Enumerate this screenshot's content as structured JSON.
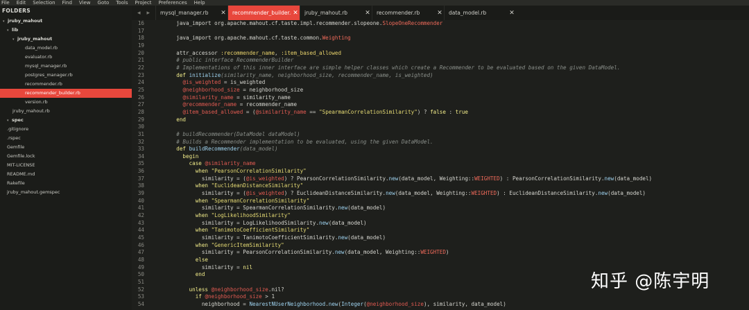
{
  "menu": [
    "File",
    "Edit",
    "Selection",
    "Find",
    "View",
    "Goto",
    "Tools",
    "Project",
    "Preferences",
    "Help"
  ],
  "sidebar": {
    "header": "FOLDERS",
    "items": [
      {
        "label": "jruby_mahout",
        "type": "folder",
        "depth": 0
      },
      {
        "label": "lib",
        "type": "folder",
        "depth": 1
      },
      {
        "label": "jruby_mahout",
        "type": "folder",
        "depth": 2
      },
      {
        "label": "data_model.rb",
        "type": "file",
        "depth": 3
      },
      {
        "label": "evaluator.rb",
        "type": "file",
        "depth": 3
      },
      {
        "label": "mysql_manager.rb",
        "type": "file",
        "depth": 3
      },
      {
        "label": "postgres_manager.rb",
        "type": "file",
        "depth": 3
      },
      {
        "label": "recommender.rb",
        "type": "file",
        "depth": 3
      },
      {
        "label": "recommender_builder.rb",
        "type": "file",
        "depth": 3,
        "active": true
      },
      {
        "label": "version.rb",
        "type": "file",
        "depth": 3
      },
      {
        "label": "jruby_mahout.rb",
        "type": "file",
        "depth": 2
      },
      {
        "label": "spec",
        "type": "folder",
        "depth": 1
      },
      {
        "label": ".gitignore",
        "type": "file",
        "depth": 1
      },
      {
        "label": ".rspec",
        "type": "file",
        "depth": 1
      },
      {
        "label": "Gemfile",
        "type": "file",
        "depth": 1
      },
      {
        "label": "Gemfile.lock",
        "type": "file",
        "depth": 1
      },
      {
        "label": "MIT-LICENSE",
        "type": "file",
        "depth": 1
      },
      {
        "label": "README.md",
        "type": "file",
        "depth": 1
      },
      {
        "label": "Rakefile",
        "type": "file",
        "depth": 1
      },
      {
        "label": "jruby_mahout.gemspec",
        "type": "file",
        "depth": 1
      }
    ]
  },
  "tabs": {
    "nav_left": "◂",
    "nav_right": "▸",
    "close_glyph": "✕",
    "items": [
      {
        "label": "mysql_manager.rb",
        "active": false
      },
      {
        "label": "recommender_builder.rb",
        "active": true
      },
      {
        "label": "jruby_mahout.rb",
        "active": false
      },
      {
        "label": "recommender.rb",
        "active": false
      },
      {
        "label": "data_model.rb",
        "active": false
      }
    ]
  },
  "editor": {
    "lines": [
      {
        "n": "16",
        "t": [
          [
            "    java_import org.apache.mahout.cf.taste.impl.recommender.slopeone.",
            "plain"
          ],
          [
            "SlopeOneRecommender",
            "const"
          ]
        ]
      },
      {
        "n": "17",
        "t": []
      },
      {
        "n": "18",
        "t": [
          [
            "    java_import org.apache.mahout.cf.taste.common.",
            "plain"
          ],
          [
            "Weighting",
            "const"
          ]
        ]
      },
      {
        "n": "19",
        "t": []
      },
      {
        "n": "20",
        "t": [
          [
            "    attr_accessor ",
            "plain"
          ],
          [
            ":recommender_name",
            "sym"
          ],
          [
            ", ",
            "plain"
          ],
          [
            ":item_based_allowed",
            "sym"
          ]
        ]
      },
      {
        "n": "21",
        "t": [
          [
            "    # public interface RecommenderBuilder",
            "cmt"
          ]
        ]
      },
      {
        "n": "22",
        "t": [
          [
            "    # Implementations of this inner interface are simple helper classes which create a Recommender to be evaluated based on the given DataModel.",
            "cmt"
          ]
        ]
      },
      {
        "n": "23",
        "t": [
          [
            "    def ",
            "kw"
          ],
          [
            "initialize",
            "fn"
          ],
          [
            "(similarity_name, neighborhood_size, recommender_name, is_weighted)",
            "cmt"
          ]
        ]
      },
      {
        "n": "24",
        "t": [
          [
            "      ",
            "plain"
          ],
          [
            "@is_weighted",
            "ivar"
          ],
          [
            " = is_weighted",
            "plain"
          ]
        ]
      },
      {
        "n": "25",
        "t": [
          [
            "      ",
            "plain"
          ],
          [
            "@neighborhood_size",
            "ivar"
          ],
          [
            " = neighborhood_size",
            "plain"
          ]
        ]
      },
      {
        "n": "26",
        "t": [
          [
            "      ",
            "plain"
          ],
          [
            "@similarity_name",
            "ivar"
          ],
          [
            " = similarity_name",
            "plain"
          ]
        ]
      },
      {
        "n": "27",
        "t": [
          [
            "      ",
            "plain"
          ],
          [
            "@recommender_name",
            "ivar"
          ],
          [
            " = recommender_name",
            "plain"
          ]
        ]
      },
      {
        "n": "28",
        "t": [
          [
            "      ",
            "plain"
          ],
          [
            "@item_based_allowed",
            "ivar"
          ],
          [
            " = (",
            "plain"
          ],
          [
            "@similarity_name",
            "ivar"
          ],
          [
            " == ",
            "plain"
          ],
          [
            "\"SpearmanCorrelationSimilarity\"",
            "str"
          ],
          [
            ") ? ",
            "plain"
          ],
          [
            "false",
            "kw"
          ],
          [
            " : ",
            "plain"
          ],
          [
            "true",
            "kw"
          ]
        ]
      },
      {
        "n": "29",
        "t": [
          [
            "    end",
            "kw"
          ]
        ]
      },
      {
        "n": "30",
        "t": []
      },
      {
        "n": "31",
        "t": [
          [
            "    # buildRecommender(DataModel dataModel)",
            "cmt"
          ]
        ]
      },
      {
        "n": "32",
        "t": [
          [
            "    # Builds a Recommender implementation to be evaluated, using the given DataModel.",
            "cmt"
          ]
        ]
      },
      {
        "n": "33",
        "t": [
          [
            "    def ",
            "kw"
          ],
          [
            "buildRecommender",
            "fn"
          ],
          [
            "(data_model)",
            "cmt"
          ]
        ]
      },
      {
        "n": "34",
        "t": [
          [
            "      begin",
            "kw"
          ]
        ]
      },
      {
        "n": "35",
        "t": [
          [
            "        case ",
            "kw"
          ],
          [
            "@similarity_name",
            "ivar"
          ]
        ]
      },
      {
        "n": "36",
        "t": [
          [
            "          when ",
            "kw"
          ],
          [
            "\"PearsonCorrelationSimilarity\"",
            "str"
          ]
        ]
      },
      {
        "n": "37",
        "t": [
          [
            "            similarity = (",
            "plain"
          ],
          [
            "@is_weighted",
            "ivar"
          ],
          [
            ") ? PearsonCorrelationSimilarity.",
            "plain"
          ],
          [
            "new",
            "fn"
          ],
          [
            "(data_model, Weighting::",
            "plain"
          ],
          [
            "WEIGHTED",
            "const"
          ],
          [
            ") : PearsonCorrelationSimilarity.",
            "plain"
          ],
          [
            "new",
            "fn"
          ],
          [
            "(data_model)",
            "plain"
          ]
        ]
      },
      {
        "n": "38",
        "t": [
          [
            "          when ",
            "kw"
          ],
          [
            "\"EuclideanDistanceSimilarity\"",
            "str"
          ]
        ]
      },
      {
        "n": "39",
        "t": [
          [
            "            similarity = (",
            "plain"
          ],
          [
            "@is_weighted",
            "ivar"
          ],
          [
            ") ? EuclideanDistanceSimilarity.",
            "plain"
          ],
          [
            "new",
            "fn"
          ],
          [
            "(data_model, Weighting::",
            "plain"
          ],
          [
            "WEIGHTED",
            "const"
          ],
          [
            ") : EuclideanDistanceSimilarity.",
            "plain"
          ],
          [
            "new",
            "fn"
          ],
          [
            "(data_model)",
            "plain"
          ]
        ]
      },
      {
        "n": "40",
        "t": [
          [
            "          when ",
            "kw"
          ],
          [
            "\"SpearmanCorrelationSimilarity\"",
            "str"
          ]
        ]
      },
      {
        "n": "41",
        "t": [
          [
            "            similarity = SpearmanCorrelationSimilarity.",
            "plain"
          ],
          [
            "new",
            "fn"
          ],
          [
            "(data_model)",
            "plain"
          ]
        ]
      },
      {
        "n": "42",
        "t": [
          [
            "          when ",
            "kw"
          ],
          [
            "\"LogLikelihoodSimilarity\"",
            "str"
          ]
        ]
      },
      {
        "n": "43",
        "t": [
          [
            "            similarity = LogLikelihoodSimilarity.",
            "plain"
          ],
          [
            "new",
            "fn"
          ],
          [
            "(data_model)",
            "plain"
          ]
        ]
      },
      {
        "n": "44",
        "t": [
          [
            "          when ",
            "kw"
          ],
          [
            "\"TanimotoCoefficientSimilarity\"",
            "str"
          ]
        ]
      },
      {
        "n": "45",
        "t": [
          [
            "            similarity = TanimotoCoefficientSimilarity.",
            "plain"
          ],
          [
            "new",
            "fn"
          ],
          [
            "(data_model)",
            "plain"
          ]
        ]
      },
      {
        "n": "46",
        "t": [
          [
            "          when ",
            "kw"
          ],
          [
            "\"GenericItemSimilarity\"",
            "str"
          ]
        ]
      },
      {
        "n": "47",
        "t": [
          [
            "            similarity = PearsonCorrelationSimilarity.",
            "plain"
          ],
          [
            "new",
            "fn"
          ],
          [
            "(data_model, Weighting::",
            "plain"
          ],
          [
            "WEIGHTED",
            "const"
          ],
          [
            ")",
            "plain"
          ]
        ]
      },
      {
        "n": "48",
        "t": [
          [
            "          else",
            "kw"
          ]
        ]
      },
      {
        "n": "49",
        "t": [
          [
            "            similarity = ",
            "plain"
          ],
          [
            "nil",
            "kw"
          ]
        ]
      },
      {
        "n": "50",
        "t": [
          [
            "          end",
            "kw"
          ]
        ]
      },
      {
        "n": "51",
        "t": []
      },
      {
        "n": "52",
        "t": [
          [
            "        unless ",
            "kw"
          ],
          [
            "@neighborhood_size",
            "ivar"
          ],
          [
            ".nil?",
            "plain"
          ]
        ]
      },
      {
        "n": "53",
        "t": [
          [
            "          if ",
            "kw"
          ],
          [
            "@neighborhood_size",
            "ivar"
          ],
          [
            " > 1",
            "plain"
          ]
        ]
      },
      {
        "n": "54",
        "t": [
          [
            "            neighborhood = ",
            "plain"
          ],
          [
            "NearestNUserNeighborhood",
            "fn"
          ],
          [
            ".",
            "plain"
          ],
          [
            "new",
            "fn"
          ],
          [
            "(",
            "plain"
          ],
          [
            "Integer",
            "fn"
          ],
          [
            "(",
            "plain"
          ],
          [
            "@neighborhood_size",
            "ivar"
          ],
          [
            "), similarity, data_model)",
            "plain"
          ]
        ]
      }
    ]
  },
  "watermark": "知乎 @陈宇明"
}
